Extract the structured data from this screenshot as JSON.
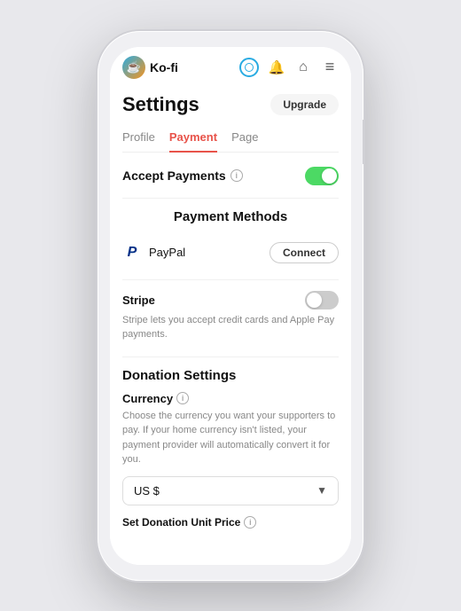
{
  "app": {
    "name": "Ko-fi"
  },
  "topbar": {
    "logo_label": "Ko-fi",
    "upgrade_label": "Upgrade"
  },
  "tabs": [
    {
      "label": "Profile",
      "active": false
    },
    {
      "label": "Payment",
      "active": true
    },
    {
      "label": "Page",
      "active": false
    }
  ],
  "accept_payments": {
    "label": "Accept Payments",
    "toggle": "on"
  },
  "payment_methods": {
    "title": "Payment Methods",
    "paypal": {
      "name": "PayPal",
      "button_label": "Connect"
    },
    "stripe": {
      "name": "Stripe",
      "toggle": "off",
      "description": "Stripe lets you accept credit cards and Apple Pay payments."
    }
  },
  "donation_settings": {
    "title": "Donation Settings",
    "currency": {
      "label": "Currency",
      "description": "Choose the currency you want your supporters to pay. If your home currency isn't listed, your payment provider will automatically convert it for you.",
      "value": "US $"
    },
    "set_donation_unit_price": {
      "label": "Set Donation Unit Price"
    }
  },
  "icons": {
    "info": "i",
    "chevron_down": "▼",
    "bell": "🔔",
    "home": "⌂",
    "menu": "≡"
  }
}
